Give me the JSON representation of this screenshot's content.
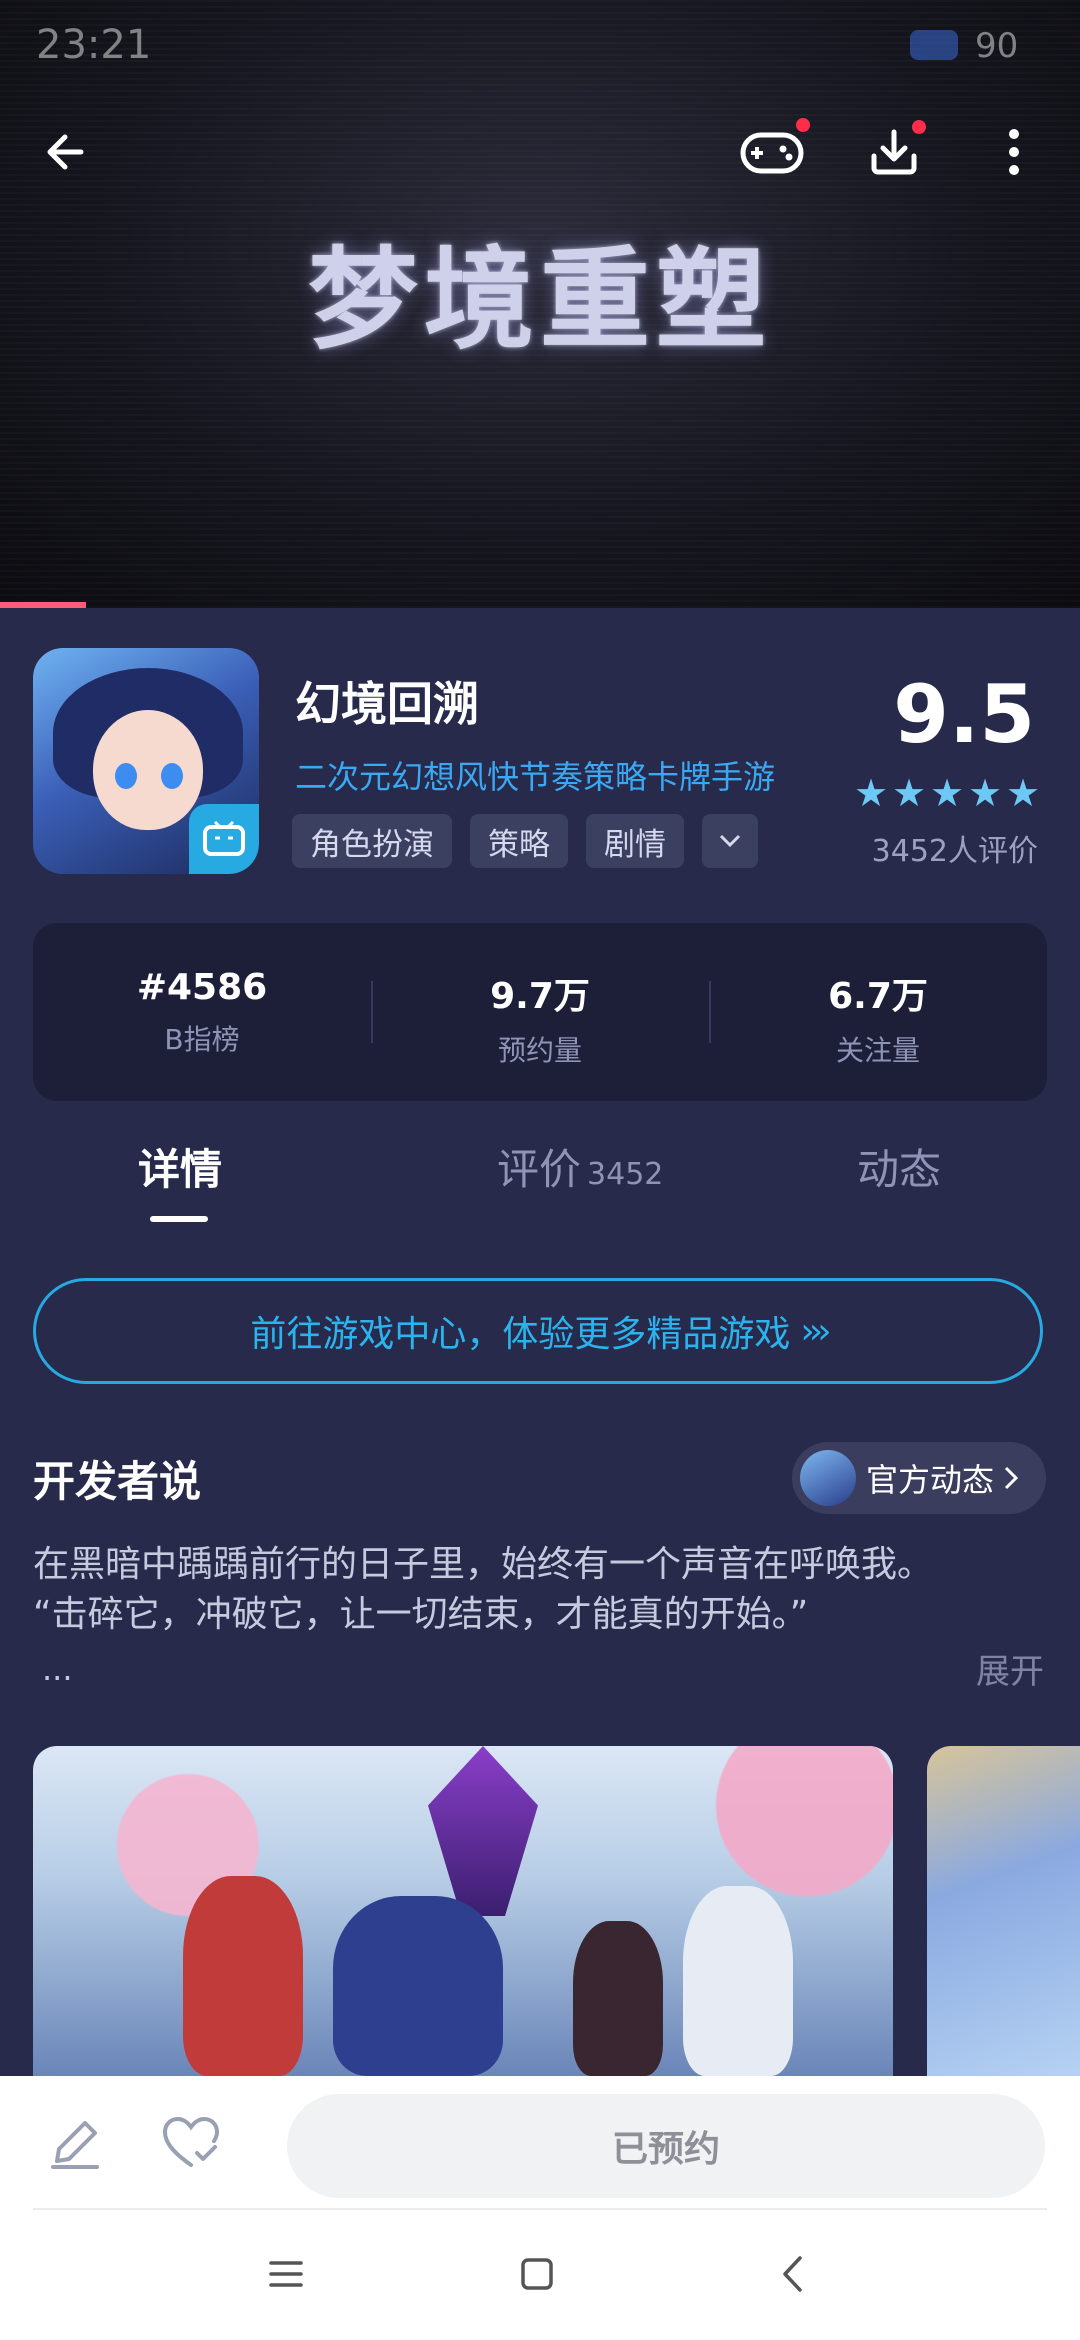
{
  "status_bar": {
    "time": "23:21",
    "battery": "90"
  },
  "banner": {
    "title": "梦境重塑"
  },
  "app": {
    "name": "幻境回溯",
    "description": "二次元幻想风快节奏策略卡牌手游",
    "tags": [
      "角色扮演",
      "策略",
      "剧情"
    ],
    "score": "9.5",
    "stars": 5,
    "rating_count": "3452人评价"
  },
  "stats": [
    {
      "value": "#4586",
      "label": "B指榜"
    },
    {
      "value": "9.7万",
      "label": "预约量"
    },
    {
      "value": "6.7万",
      "label": "关注量"
    }
  ],
  "tabs": [
    {
      "label": "详情",
      "count": ""
    },
    {
      "label": "评价",
      "count": "3452"
    },
    {
      "label": "动态",
      "count": ""
    }
  ],
  "cta": {
    "label": "前往游戏中心，体验更多精品游戏"
  },
  "developer": {
    "title": "开发者说",
    "official_label": "官方动态",
    "lines": [
      "在黑暗中踽踽前行的日子里，始终有一个声音在呼唤我。",
      "“击碎它，冲破它，让一切结束，才能真的开始。”"
    ],
    "ellipsis": "...",
    "expand_label": "展开"
  },
  "bottom": {
    "reserve_label": "已预约"
  },
  "colors": {
    "accent": "#27a9e1",
    "background": "#272a4a",
    "card": "#1d1f38",
    "badge_red": "#ff2d4a"
  }
}
